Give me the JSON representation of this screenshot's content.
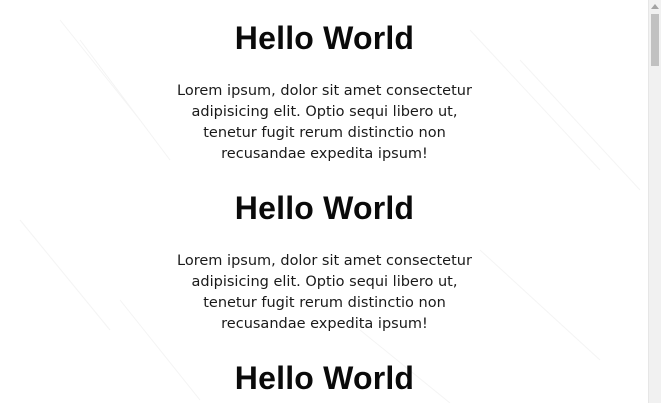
{
  "sections": [
    {
      "heading": "Hello World",
      "lines": [
        "Lorem ipsum, dolor sit amet consectetur",
        "adipisicing elit. Optio sequi libero ut,",
        "tenetur fugit rerum distinctio non",
        "recusandae expedita ipsum!"
      ]
    },
    {
      "heading": "Hello World",
      "lines": [
        "Lorem ipsum, dolor sit amet consectetur",
        "adipisicing elit. Optio sequi libero ut,",
        "tenetur fugit rerum distinctio non",
        "recusandae expedita ipsum!"
      ]
    },
    {
      "heading": "Hello World",
      "lines": []
    }
  ],
  "scrollbar": {
    "position_fraction": 0.0
  }
}
